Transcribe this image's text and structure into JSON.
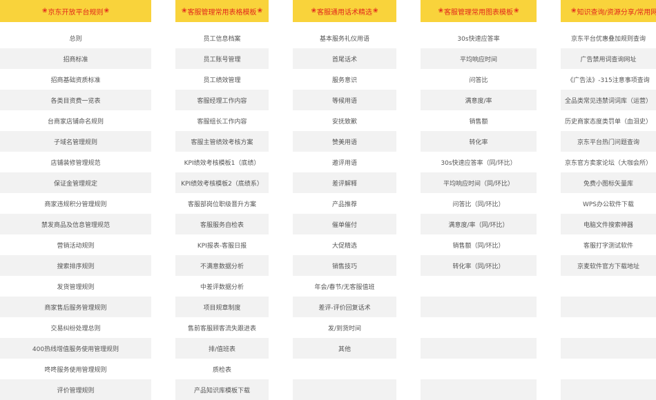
{
  "colors": {
    "header_bg": "#f9d33b",
    "header_text": "#e2281c",
    "row_alt": "#f2f2f2"
  },
  "star_glyph": "❀",
  "columns": [
    {
      "title": "京东开放平台规则",
      "items": [
        "总则",
        "招商标准",
        "招商基础资质标准",
        "各类目资费一览表",
        "台商家店铺命名规则",
        "子域名管理规则",
        "店铺装修管理规范",
        "保证金管理规定",
        "商家违规积分管理规则",
        "禁发商品及信息管理规范",
        "营销活动规则",
        "搜索排序规则",
        "发货管理规则",
        "商家售后服务管理规则",
        "交易纠纷处理总则",
        "400热线增值服务使用管理规则",
        "咚咚服务使用管理规则",
        "评价管理规则"
      ]
    },
    {
      "title": "客服管理常用表格模板",
      "items": [
        "员工信息档案",
        "员工账号管理",
        "员工绩效管理",
        "客服经理工作内容",
        "客服组长工作内容",
        "客服主管绩效考核方案",
        "KPI绩效考核模板1（底绩）",
        "KPI绩效考核模板2（底绩系）",
        "客服部岗位职级晋升方案",
        "客服服务自检表",
        "KPI报表-客服日报",
        "不满意数据分析",
        "中差评数据分析",
        "项目规章制度",
        "售前客服顾客流失跟进表",
        "排/值班表",
        "质检表",
        "产品知识库模板下载"
      ]
    },
    {
      "title": "客服通用话术精选",
      "items": [
        "基本服务礼仪用语",
        "首尾话术",
        "服务意识",
        "等候用语",
        "安抚致歉",
        "赞美用语",
        "邀评用语",
        "差评解释",
        "产品推荐",
        "催单催付",
        "大促精选",
        "销售技巧",
        "年会/春节/无客服值班",
        "差评-评价回复话术",
        "发/到货时间",
        "其他",
        "",
        ""
      ]
    },
    {
      "title": "客服管理常用图表模板",
      "items": [
        "30s快速应答率",
        "平均响应时间",
        "问答比",
        "满意度/率",
        "销售额",
        "转化率",
        "30s快速应答率（同/环比）",
        "平均响应时间（同/环比）",
        "问答比（同/环比）",
        "满意度/率（同/环比）",
        "销售额（同/环比）",
        "转化率（同/环比）",
        "",
        "",
        "",
        "",
        "",
        ""
      ]
    },
    {
      "title": "知识查询/资源分享/常用网址",
      "items": [
        "京东平台优惠叠加规则查询",
        "广告禁用词查询网址",
        "《广告法》-315注意事项查询",
        "全品类常见违禁词词库（运营）",
        "历史商家态度类罚单（血泪史）",
        "京东平台热门问题查询",
        "京东官方卖家论坛（大咖会所）",
        "免费小图标矢量库",
        "WPS办公软件下载",
        "电脑文件搜索神器",
        "客服打字测试软件",
        "京麦软件官方下载地址",
        "",
        "",
        "",
        "",
        "",
        ""
      ]
    }
  ]
}
